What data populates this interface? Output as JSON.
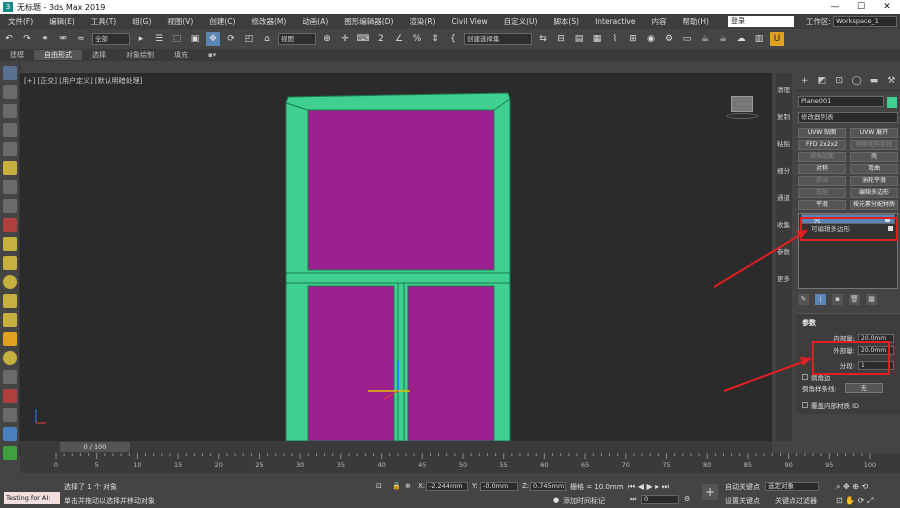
{
  "window": {
    "title": "无标题 - 3ds Max 2019",
    "min": "—",
    "max": "☐",
    "close": "✕"
  },
  "menu": {
    "items": [
      "文件(F)",
      "编辑(E)",
      "工具(T)",
      "组(G)",
      "视图(V)",
      "创建(C)",
      "修改器(M)",
      "动画(A)",
      "图形编辑器(D)",
      "渲染(R)",
      "Civil View",
      "自定义(U)",
      "脚本(S)",
      "Interactive",
      "内容",
      "帮助(H)"
    ],
    "login": "登录",
    "workspace_label": "工作区:",
    "workspace": "Workspace_1"
  },
  "toolbar": {
    "selection_filter": "全部",
    "ref_coord": "视图",
    "named_selection": "创建选择集"
  },
  "ribbon": {
    "tabs": [
      "建模",
      "自由形式",
      "选择",
      "对象绘制",
      "填充"
    ],
    "active": 1
  },
  "viewport": {
    "label": "[+] [正交] [用户定义] [默认明暗处理]"
  },
  "side_tabs": [
    "清理",
    "复制",
    "粘贴",
    "细分",
    "通道",
    "收集",
    "参数",
    "更多"
  ],
  "command_panel": {
    "object_name": "Plane001",
    "modifier_list": "修改器列表",
    "buttons": [
      [
        "UVW 贴图",
        "UVW 展开"
      ],
      [
        "FFD 2x2x2",
        "网格化样条线"
      ],
      [
        "倒角剖面",
        "壳"
      ],
      [
        "对称",
        "弯曲"
      ],
      [
        "挤出",
        "涡轮平滑"
      ],
      [
        "车削",
        "编辑多边形"
      ],
      [
        "平滑",
        "按元素分配材质"
      ]
    ],
    "stack": [
      "壳",
      "可编辑多边形"
    ],
    "rollout_title": "参数",
    "inner_label": "内部量:",
    "inner_value": "20.0mm",
    "outer_label": "外部量:",
    "outer_value": "20.0mm",
    "segments_label": "分段:",
    "segments_value": "1",
    "bevel_edges": "倒角边",
    "bevel_spline_label": "倒角样条线:",
    "bevel_spline_value": "无",
    "override_inner": "覆盖内部材质 ID"
  },
  "timeline": {
    "frame": "0 / 100",
    "ticks": [
      "0",
      "5",
      "10",
      "15",
      "20",
      "25",
      "30",
      "35",
      "40",
      "45",
      "50",
      "55",
      "60",
      "65",
      "70",
      "75",
      "80",
      "85",
      "90",
      "95",
      "100"
    ]
  },
  "status": {
    "maxscript": "Testing for AI:",
    "selected": "选择了 1 个 对象",
    "hint": "单击并拖动以选择并移动对象",
    "x_label": "X:",
    "x": "-2.244mm",
    "y_label": "Y:",
    "y": "-0.0mm",
    "z_label": "Z:",
    "z": "0.745mm",
    "grid": "栅格 = 10.0mm",
    "add_time_tag": "添加时间标记",
    "auto_key": "自动关键点",
    "set_key": "设置关键点",
    "selected_obj": "选定对象",
    "key_filter": "关键点过滤器",
    "frame": "0"
  },
  "colors": {
    "frame": "#3fcf8e",
    "panel": "#9b1f8c",
    "annotation": "#e02020"
  }
}
